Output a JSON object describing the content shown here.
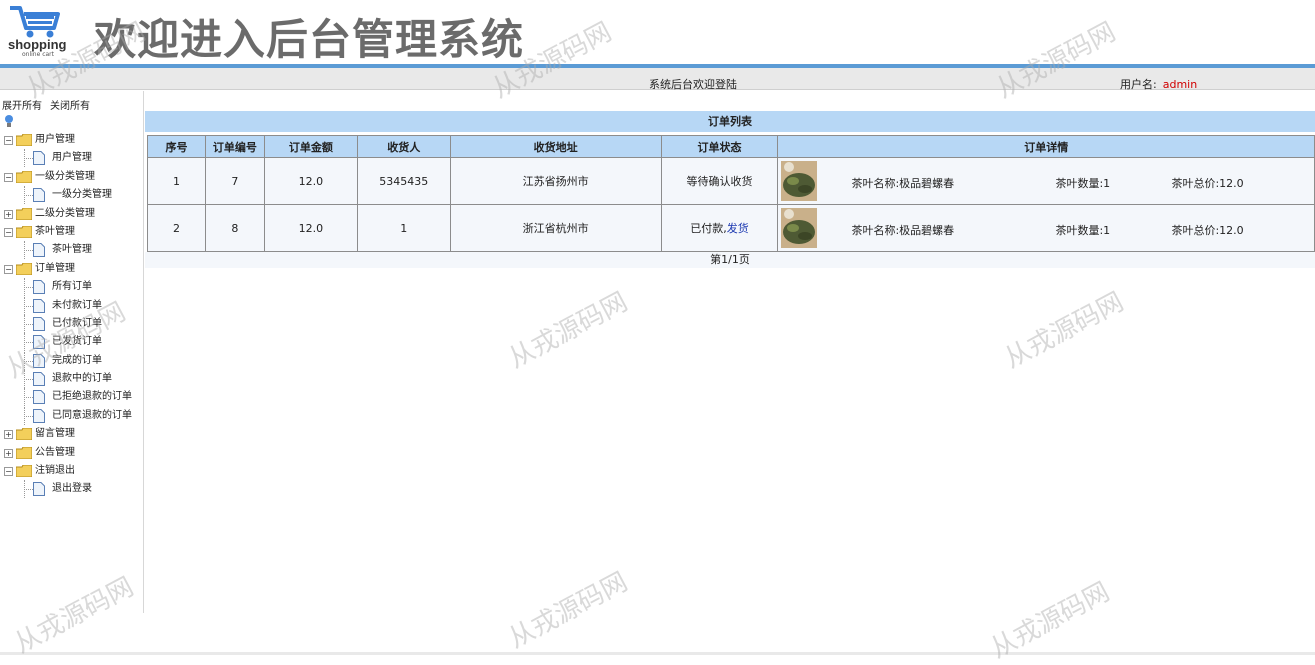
{
  "header": {
    "logo_text": "shopping",
    "logo_sub": "online cart",
    "title": "欢迎进入后台管理系统"
  },
  "topbar": {
    "welcome": "系统后台欢迎登陆",
    "user_label": "用户名:",
    "user_name": "admin"
  },
  "sidebar": {
    "expand_all": "展开所有",
    "collapse_all": "关闭所有",
    "groups": [
      {
        "label": "用户管理",
        "expanded": true,
        "children": [
          "用户管理"
        ]
      },
      {
        "label": "一级分类管理",
        "expanded": true,
        "children": [
          "一级分类管理"
        ]
      },
      {
        "label": "二级分类管理",
        "expanded": false,
        "children": []
      },
      {
        "label": "茶叶管理",
        "expanded": true,
        "children": [
          "茶叶管理"
        ]
      },
      {
        "label": "订单管理",
        "expanded": true,
        "children": [
          "所有订单",
          "未付款订单",
          "已付款订单",
          "已发货订单",
          "完成的订单",
          "退款中的订单",
          "已拒绝退款的订单",
          "已同意退款的订单"
        ]
      },
      {
        "label": "留言管理",
        "expanded": false,
        "children": []
      },
      {
        "label": "公告管理",
        "expanded": false,
        "children": []
      },
      {
        "label": "注销退出",
        "expanded": true,
        "children": [
          "退出登录"
        ]
      }
    ]
  },
  "orders": {
    "title": "订单列表",
    "columns": [
      "序号",
      "订单编号",
      "订单金额",
      "收货人",
      "收货地址",
      "订单状态",
      "订单详情"
    ],
    "rows": [
      {
        "index": "1",
        "order_no": "7",
        "amount": "12.0",
        "receiver": "5345435",
        "address": "江苏省扬州市",
        "status": "等待确认收货",
        "action": "",
        "tea_name": "茶叶名称:极品碧螺春",
        "tea_qty": "茶叶数量:1",
        "tea_total": "茶叶总价:12.0"
      },
      {
        "index": "2",
        "order_no": "8",
        "amount": "12.0",
        "receiver": "1",
        "address": "浙江省杭州市",
        "status": "已付款,",
        "action": "发货",
        "tea_name": "茶叶名称:极品碧螺春",
        "tea_qty": "茶叶数量:1",
        "tea_total": "茶叶总价:12.0"
      }
    ],
    "pager": "第1/1页"
  },
  "watermark": "从戎源码网",
  "colors": {
    "accent_blue": "#5b9bd5",
    "header_blue": "#b7d7f5",
    "user_red": "#d00000",
    "link_blue": "#1a37b0"
  }
}
